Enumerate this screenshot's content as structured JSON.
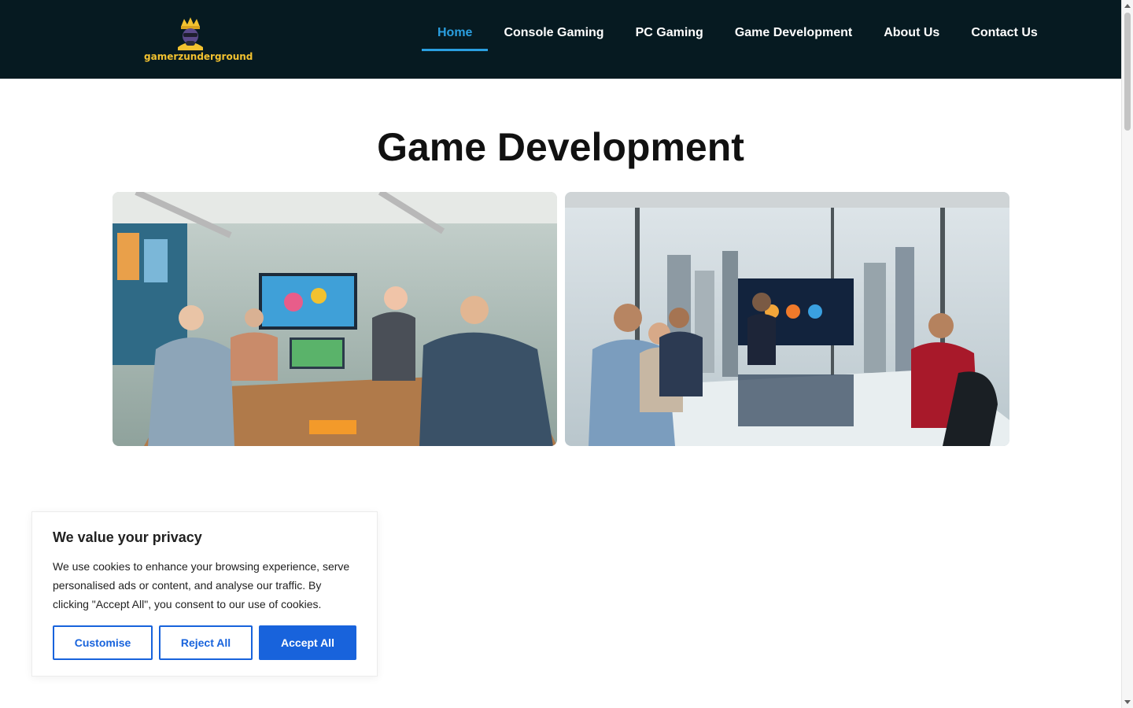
{
  "header": {
    "logo_text": "gamerzunderground",
    "logo_icon": "crowned-gamer-mascot-icon",
    "nav": [
      {
        "label": "Home",
        "active": true
      },
      {
        "label": "Console Gaming",
        "active": false
      },
      {
        "label": "PC Gaming",
        "active": false
      },
      {
        "label": "Game Development",
        "active": false
      },
      {
        "label": "About Us",
        "active": false
      },
      {
        "label": "Contact Us",
        "active": false
      }
    ]
  },
  "main": {
    "title": "Game Development",
    "images": [
      {
        "name": "game-studio-team-meeting-photo"
      },
      {
        "name": "corporate-gaming-presentation-photo"
      }
    ]
  },
  "cookie_banner": {
    "title": "We value your privacy",
    "text": "We use cookies to enhance your browsing experience, serve personalised ads or content, and analyse our traffic. By clicking \"Accept All\", you consent to our use of cookies.",
    "buttons": {
      "customise": "Customise",
      "reject": "Reject All",
      "accept": "Accept All"
    }
  },
  "colors": {
    "header_bg": "#061a21",
    "nav_active": "#2a9fe0",
    "logo_gold": "#f2c230",
    "button_blue": "#1863dc"
  }
}
